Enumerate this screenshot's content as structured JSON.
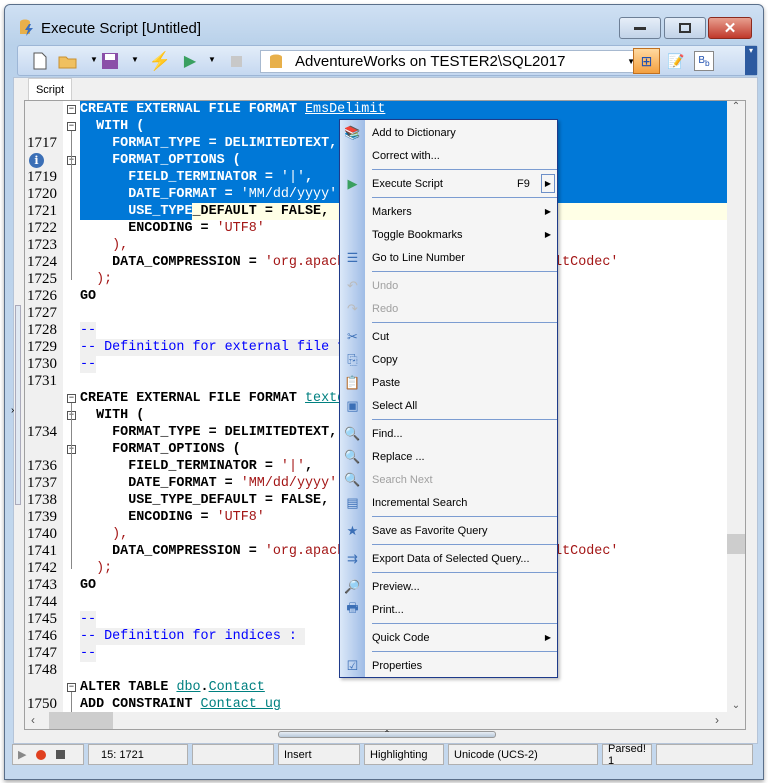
{
  "window": {
    "title": "Execute Script [Untitled]"
  },
  "toolbar": {
    "database": "AdventureWorks on TESTER2\\SQL2017"
  },
  "tabs": [
    {
      "label": "Script"
    }
  ],
  "editor": {
    "lines": [
      {
        "n": "",
        "fold": true,
        "parts": [
          [
            "kw",
            "CREATE EXTERNAL FILE FORMAT "
          ],
          [
            "obj",
            "EmsDelimit"
          ]
        ]
      },
      {
        "n": "",
        "fold": true,
        "parts": [
          [
            "kw",
            "  WITH ("
          ]
        ]
      },
      {
        "n": "1717",
        "parts": [
          [
            "kw",
            "    FORMAT_TYPE = DELIMITEDTEXT,"
          ]
        ]
      },
      {
        "n": "",
        "info": true,
        "fold": true,
        "parts": [
          [
            "kw",
            "    FORMAT_OPTIONS ("
          ]
        ]
      },
      {
        "n": "1719",
        "parts": [
          [
            "kw",
            "      FIELD_TERMINATOR = "
          ],
          [
            "str",
            "'|'"
          ],
          [
            "kw",
            ","
          ]
        ]
      },
      {
        "n": "1720",
        "parts": [
          [
            "kw",
            "      DATE_FORMAT = "
          ],
          [
            "str",
            "'MM/dd/yyyy'"
          ]
        ]
      },
      {
        "n": "1721",
        "parts": [
          [
            "kw",
            "      USE_TYPE_DEFAULT = FALSE,"
          ]
        ]
      },
      {
        "n": "1722",
        "parts": [
          [
            "kw",
            "      ENCODING = "
          ],
          [
            "str",
            "'UTF8'"
          ]
        ]
      },
      {
        "n": "1723",
        "parts": [
          [
            "str",
            "    ),"
          ]
        ]
      },
      {
        "n": "1724",
        "parts": [
          [
            "kw",
            "    DATA_COMPRESSION = "
          ],
          [
            "str",
            "'org.apache.hadoop.io.compress.DefaultCodec'"
          ]
        ]
      },
      {
        "n": "1725",
        "parts": [
          [
            "str",
            "  );"
          ]
        ]
      },
      {
        "n": "1726",
        "parts": [
          [
            "kw",
            "GO"
          ]
        ]
      },
      {
        "n": "1727",
        "parts": []
      },
      {
        "n": "1728",
        "comment": true,
        "parts": [
          [
            "cm",
            "--"
          ]
        ]
      },
      {
        "n": "1729",
        "comment": true,
        "parts": [
          [
            "cm",
            "-- Definition for external file format :"
          ]
        ]
      },
      {
        "n": "1730",
        "comment": true,
        "parts": [
          [
            "cm",
            "--"
          ]
        ]
      },
      {
        "n": "1731",
        "parts": []
      },
      {
        "n": "",
        "fold": true,
        "parts": [
          [
            "kw",
            "CREATE EXTERNAL FILE FORMAT "
          ],
          [
            "obj",
            "textdelimited"
          ]
        ]
      },
      {
        "n": "",
        "fold": true,
        "parts": [
          [
            "kw",
            "  WITH ("
          ]
        ]
      },
      {
        "n": "1734",
        "parts": [
          [
            "kw",
            "    FORMAT_TYPE = DELIMITEDTEXT,"
          ]
        ]
      },
      {
        "n": "",
        "fold": true,
        "parts": [
          [
            "kw",
            "    FORMAT_OPTIONS ("
          ]
        ]
      },
      {
        "n": "1736",
        "parts": [
          [
            "kw",
            "      FIELD_TERMINATOR = "
          ],
          [
            "str",
            "'|'"
          ],
          [
            "kw",
            ","
          ]
        ]
      },
      {
        "n": "1737",
        "parts": [
          [
            "kw",
            "      DATE_FORMAT = "
          ],
          [
            "str",
            "'MM/dd/yyyy'"
          ]
        ]
      },
      {
        "n": "1738",
        "parts": [
          [
            "kw",
            "      USE_TYPE_DEFAULT = FALSE,"
          ]
        ]
      },
      {
        "n": "1739",
        "parts": [
          [
            "kw",
            "      ENCODING = "
          ],
          [
            "str",
            "'UTF8'"
          ]
        ]
      },
      {
        "n": "1740",
        "parts": [
          [
            "str",
            "    ),"
          ]
        ]
      },
      {
        "n": "1741",
        "parts": [
          [
            "kw",
            "    DATA_COMPRESSION = "
          ],
          [
            "str",
            "'org.apache.hadoop.io.compress.DefaultCodec'"
          ]
        ]
      },
      {
        "n": "1742",
        "parts": [
          [
            "str",
            "  );"
          ]
        ]
      },
      {
        "n": "1743",
        "parts": [
          [
            "kw",
            "GO"
          ]
        ]
      },
      {
        "n": "1744",
        "parts": []
      },
      {
        "n": "1745",
        "comment": true,
        "parts": [
          [
            "cm",
            "--"
          ]
        ]
      },
      {
        "n": "1746",
        "comment": true,
        "parts": [
          [
            "cm",
            "-- Definition for indices :"
          ]
        ]
      },
      {
        "n": "1747",
        "comment": true,
        "parts": [
          [
            "cm",
            "--"
          ]
        ]
      },
      {
        "n": "1748",
        "parts": []
      },
      {
        "n": "",
        "fold": true,
        "parts": [
          [
            "kw",
            "ALTER TABLE "
          ],
          [
            "obj",
            "dbo"
          ],
          [
            "kw",
            "."
          ],
          [
            "obj",
            "Contact"
          ]
        ]
      },
      {
        "n": "1750",
        "parts": [
          [
            "kw",
            "ADD CONSTRAINT "
          ],
          [
            "obj",
            "Contact_ug"
          ]
        ]
      }
    ],
    "selection_color": "#0078d7",
    "current_line_color": "#ffffe6"
  },
  "context_menu": {
    "items": [
      {
        "label": "Add to Dictionary",
        "icon": "dictionary-icon"
      },
      {
        "label": "Correct with...",
        "icon": ""
      },
      {
        "sep": true
      },
      {
        "label": "Execute Script",
        "shortcut": "F9",
        "submenu": true,
        "icon": "play-icon"
      },
      {
        "sep": true
      },
      {
        "label": "Markers",
        "submenu": true
      },
      {
        "label": "Toggle Bookmarks",
        "submenu": true
      },
      {
        "label": "Go to Line Number",
        "icon": "goto-line-icon"
      },
      {
        "sep": true
      },
      {
        "label": "Undo",
        "disabled": true,
        "icon": "undo-icon"
      },
      {
        "label": "Redo",
        "disabled": true,
        "icon": "redo-icon"
      },
      {
        "sep": true
      },
      {
        "label": "Cut",
        "icon": "cut-icon"
      },
      {
        "label": "Copy",
        "icon": "copy-icon"
      },
      {
        "label": "Paste",
        "icon": "paste-icon"
      },
      {
        "label": "Select All",
        "icon": "select-all-icon"
      },
      {
        "sep": true
      },
      {
        "label": "Find...",
        "icon": "find-icon"
      },
      {
        "label": "Replace ...",
        "icon": "replace-icon"
      },
      {
        "label": "Search Next",
        "disabled": true,
        "icon": "search-next-icon"
      },
      {
        "label": "Incremental Search",
        "icon": "incremental-search-icon"
      },
      {
        "sep": true
      },
      {
        "label": "Save as Favorite Query",
        "icon": "favorite-icon"
      },
      {
        "sep": true
      },
      {
        "label": "Export Data of Selected Query...",
        "icon": "export-icon"
      },
      {
        "sep": true
      },
      {
        "label": "Preview...",
        "icon": "preview-icon"
      },
      {
        "label": "Print...",
        "icon": "print-icon"
      },
      {
        "sep": true
      },
      {
        "label": "Quick Code",
        "submenu": true
      },
      {
        "sep": true
      },
      {
        "label": "Properties",
        "icon": "properties-icon"
      }
    ]
  },
  "status": {
    "position": "15: 1721",
    "mode": "Insert",
    "highlighting": "Highlighting",
    "encoding": "Unicode (UCS-2)",
    "parsed": "Parsed! 1"
  }
}
